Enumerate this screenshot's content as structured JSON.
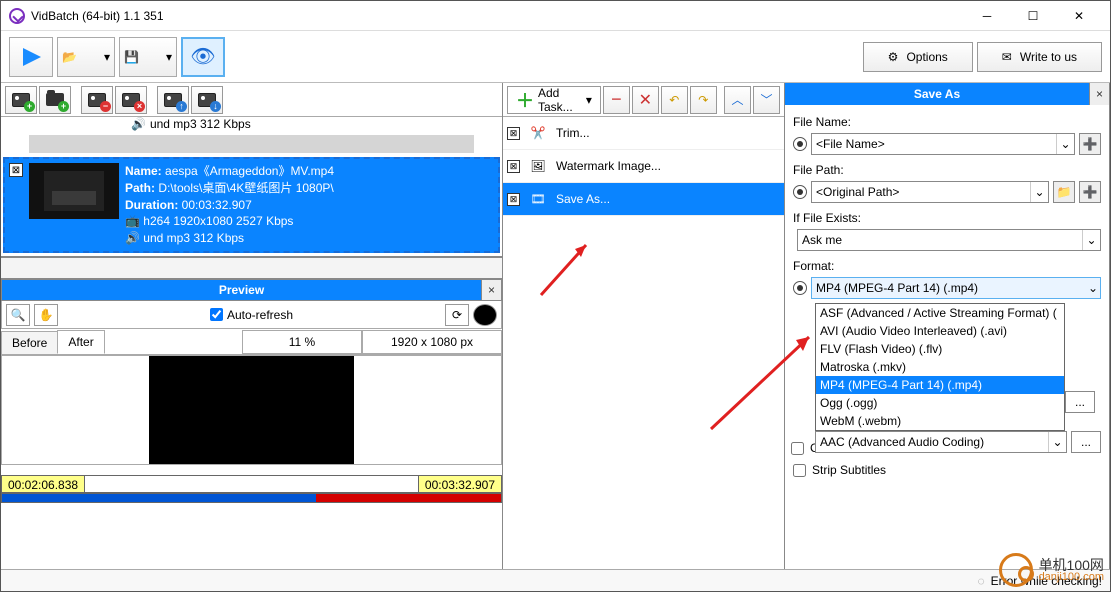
{
  "title": "VidBatch (64-bit) 1.1 351",
  "toolbar": {
    "options_label": "Options",
    "write_label": "Write to us"
  },
  "file": {
    "partial_codec": "und mp3 312 Kbps",
    "name_label": "Name:",
    "name_value": "aespa《Armageddon》MV.mp4",
    "path_label": "Path:",
    "path_value": "D:\\tools\\桌面\\4K壁纸图片 1080P\\",
    "duration_label": "Duration:",
    "duration_value": "00:03:32.907",
    "video_codec": "h264 1920x1080 2527 Kbps",
    "audio_codec": "und mp3 312 Kbps"
  },
  "preview": {
    "title": "Preview",
    "auto_refresh": "Auto-refresh",
    "pct": "11 %",
    "dim": "1920 x 1080 px",
    "tab_before": "Before",
    "tab_after": "After",
    "time_start": "00:02:06.838",
    "time_end": "00:03:32.907"
  },
  "tasks": {
    "add_label": "Add Task...",
    "items": [
      {
        "label": "Trim..."
      },
      {
        "label": "Watermark Image..."
      },
      {
        "label": "Save As..."
      }
    ]
  },
  "saveas": {
    "title": "Save As",
    "filename_label": "File Name:",
    "filename_value": "<File Name>",
    "filepath_label": "File Path:",
    "filepath_value": "<Original Path>",
    "exists_label": "If File Exists:",
    "exists_value": "Ask me",
    "format_label": "Format:",
    "format_value": "MP4 (MPEG-4 Part 14) (.mp4)",
    "format_options": [
      "ASF (Advanced / Active Streaming Format) (",
      "AVI (Audio Video Interleaved) (.avi)",
      "FLV (Flash Video) (.flv)",
      "Matroska (.mkv)",
      "MP4 (MPEG-4 Part 14) (.mp4)",
      "Ogg (.ogg)",
      "WebM (.webm)"
    ],
    "format_selected_index": 4,
    "audio_value": "AAC (Advanced Audio Coding)",
    "strip_label": "Strip Subtitles",
    "checkbox_partial": "C"
  },
  "status": {
    "text": "Error while checking!"
  },
  "watermark": {
    "line1": "单机100网",
    "line2": "danji100.com"
  }
}
